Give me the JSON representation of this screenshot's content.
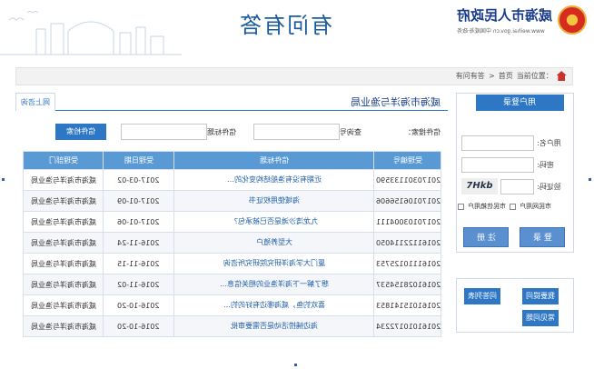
{
  "header": {
    "page_title": "有问有答",
    "brand_name": "威海市人民政府",
    "brand_sub": "www.weihai.gov.cn 中国威海·政务"
  },
  "breadcrumb": {
    "prefix": "当前位置：",
    "home": "首页",
    "separator": ">",
    "current": "有问有答"
  },
  "sidebar": {
    "login_title": "用户登录",
    "username_label": "用户名:",
    "password_label": "密码:",
    "captcha_label": "验证码:",
    "captcha_text": "7Hkb",
    "radio_a": "市民网用户",
    "radio_b": "市民信箱用户",
    "login_button": "登 录",
    "register_button": "注 册",
    "write_letter": "我要提问",
    "my_letters": "问答列表",
    "faq": "常见问题"
  },
  "main": {
    "tab_label": "网上咨询",
    "section_title": "威海市海洋与渔业局",
    "search_label": "信件搜索：",
    "code_label": "查询号",
    "title_label": "信件标题",
    "search_button": "信件检索"
  },
  "table": {
    "headers": [
      "受理编号",
      "信件标题",
      "受理日期",
      "受理部门"
    ],
    "rows": [
      {
        "id": "WD20170301133590",
        "subject": "近期有没有渔船结构变化的…",
        "date": "2017-03-02",
        "dept": "威海市海洋与渔业局"
      },
      {
        "id": "WD20170106156606",
        "subject": "海域使用权证书",
        "date": "2017-01-09",
        "dept": "威海市海洋与渔业局"
      },
      {
        "id": "WD20170103004111",
        "subject": "九龙湾沙滩是否已被承包？",
        "date": "2017-01-06",
        "dept": "威海市海洋与渔业局"
      },
      {
        "id": "WD20161122114050",
        "subject": "大型养殖户",
        "date": "2016-11-24",
        "dept": "威海市海洋与渔业局"
      },
      {
        "id": "WD20161110125753",
        "subject": "厦门大学海洋研究院研究所咨询",
        "date": "2016-11-15",
        "dept": "威海市海洋与渔业局"
      },
      {
        "id": "WD20161028154537",
        "subject": "想了解一下海洋渔业的相关信息…",
        "date": "2016-11-02",
        "dept": "威海市海洋与渔业局"
      },
      {
        "id": "WD20161015141853",
        "subject": "喜欢钓鱼，威海哪边有好的钓…",
        "date": "2016-10-20",
        "dept": "威海市海洋与渔业局"
      },
      {
        "id": "WD20161010172234",
        "subject": "海边捕捞活动是否需要审批",
        "date": "2016-10-20",
        "dept": "威海市海洋与渔业局"
      }
    ]
  },
  "colors": {
    "accent": "#2e77c4",
    "header_row": "#5a9ad4",
    "title": "#1a3c8a"
  }
}
